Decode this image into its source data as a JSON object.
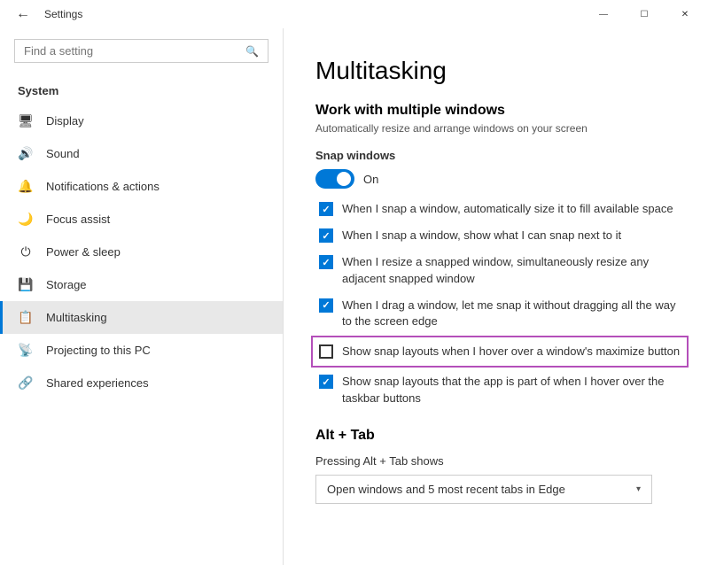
{
  "titleBar": {
    "title": "Settings",
    "backIcon": "←",
    "minimizeIcon": "—",
    "maximizeIcon": "☐",
    "closeIcon": "✕"
  },
  "sidebar": {
    "searchPlaceholder": "Find a setting",
    "sectionLabel": "System",
    "navItems": [
      {
        "id": "display",
        "label": "Display",
        "icon": "🖥"
      },
      {
        "id": "sound",
        "label": "Sound",
        "icon": "🔊"
      },
      {
        "id": "notifications",
        "label": "Notifications & actions",
        "icon": "🔔"
      },
      {
        "id": "focus",
        "label": "Focus assist",
        "icon": "🌙"
      },
      {
        "id": "power",
        "label": "Power & sleep",
        "icon": "⏻"
      },
      {
        "id": "storage",
        "label": "Storage",
        "icon": "💾"
      },
      {
        "id": "multitasking",
        "label": "Multitasking",
        "icon": "📋",
        "active": true
      },
      {
        "id": "projecting",
        "label": "Projecting to this PC",
        "icon": "📡"
      },
      {
        "id": "shared",
        "label": "Shared experiences",
        "icon": "🔗"
      }
    ]
  },
  "content": {
    "pageTitle": "Multitasking",
    "sections": [
      {
        "id": "multiple-windows",
        "title": "Work with multiple windows",
        "description": "Automatically resize and arrange windows on your screen",
        "snapLabel": "Snap windows",
        "toggleState": "On",
        "checkboxes": [
          {
            "id": "cb1",
            "checked": true,
            "text": "When I snap a window, automatically size it to fill available space",
            "highlight": false
          },
          {
            "id": "cb2",
            "checked": true,
            "text": "When I snap a window, show what I can snap next to it",
            "highlight": false
          },
          {
            "id": "cb3",
            "checked": true,
            "text": "When I resize a snapped window, simultaneously resize any adjacent snapped window",
            "highlight": false
          },
          {
            "id": "cb4",
            "checked": true,
            "text": "When I drag a window, let me snap it without dragging all the way to the screen edge",
            "highlight": false
          },
          {
            "id": "cb5",
            "checked": false,
            "text": "Show snap layouts when I hover over a window's maximize button",
            "highlight": true
          },
          {
            "id": "cb6",
            "checked": true,
            "text": "Show snap layouts that the app is part of when I hover over the taskbar buttons",
            "highlight": false
          }
        ]
      },
      {
        "id": "alt-tab",
        "title": "Alt + Tab",
        "dropdownLabel": "Pressing Alt + Tab shows",
        "dropdownValue": "Open windows and 5 most recent tabs in Edge"
      }
    ]
  }
}
